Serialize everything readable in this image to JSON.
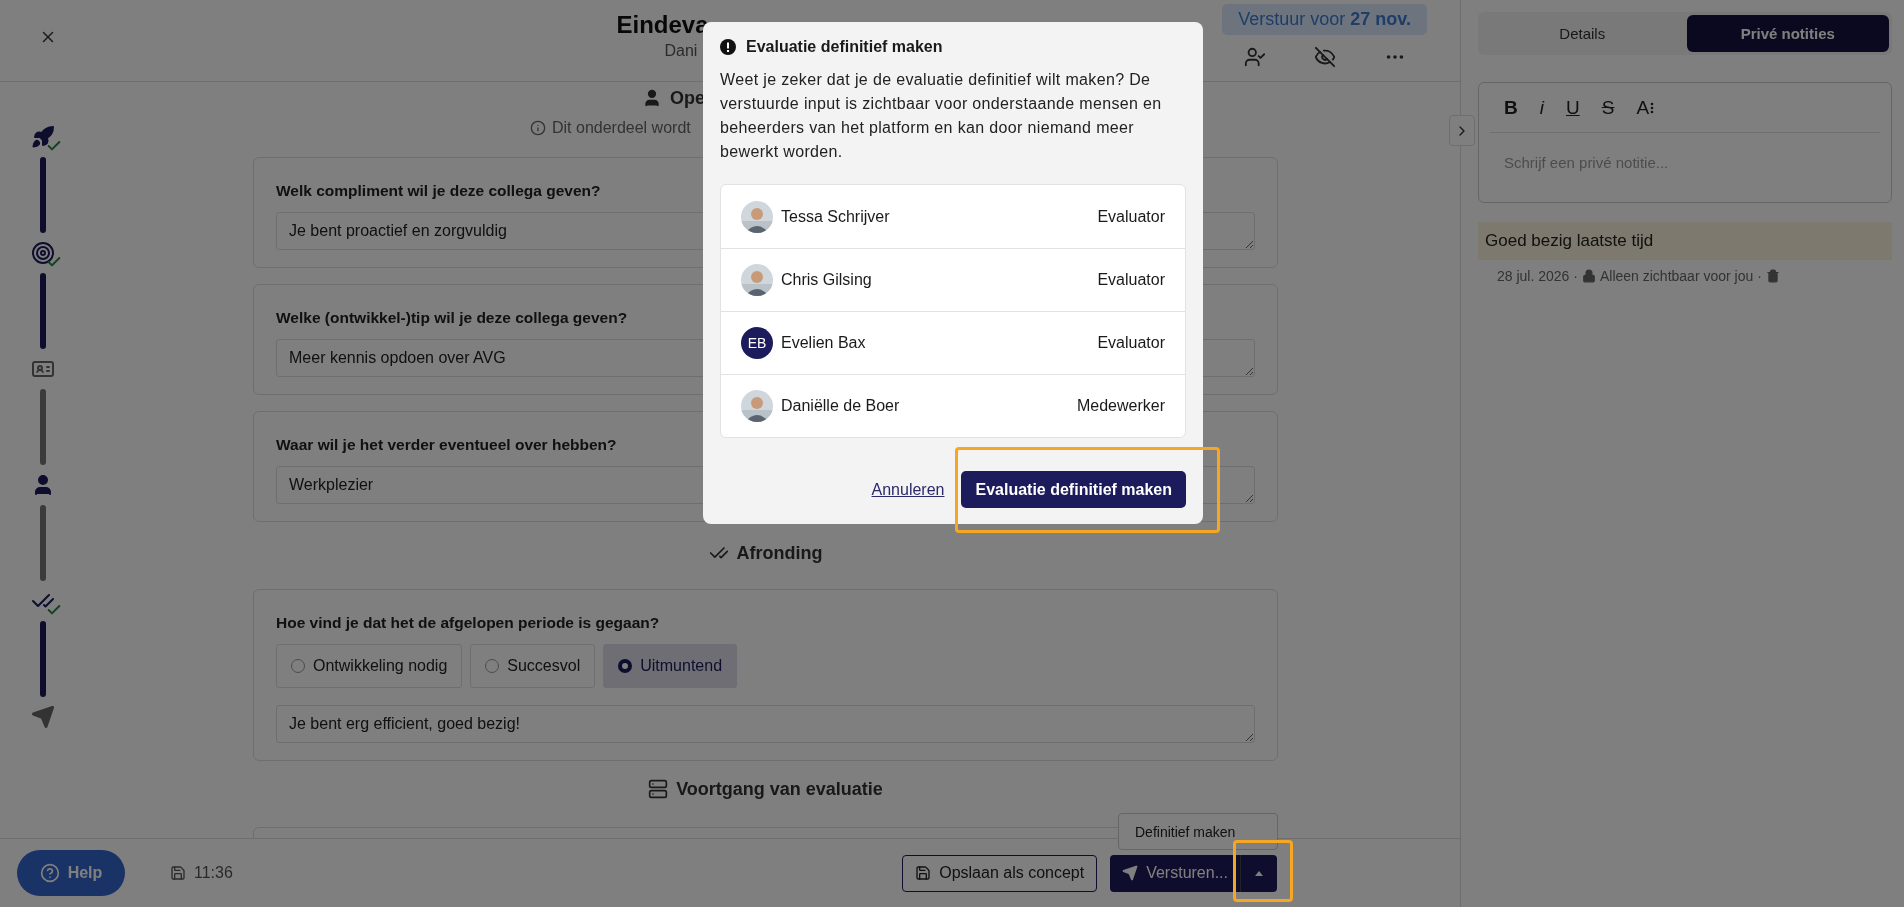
{
  "header": {
    "title": "Eindeva",
    "subtitle": "Dani",
    "deadline_badge": "Verstuur voor **27 nov.**"
  },
  "stepper": [
    {
      "kind": "rocket",
      "done": true,
      "current": false,
      "line_done": true
    },
    {
      "kind": "target",
      "done": true,
      "current": false,
      "line_done": true
    },
    {
      "kind": "id-card",
      "done": false,
      "current": false,
      "line_done": false
    },
    {
      "kind": "person",
      "done": false,
      "current": true,
      "line_done": false
    },
    {
      "kind": "checks",
      "done": true,
      "current": false,
      "line_done": true
    },
    {
      "kind": "send",
      "done": false,
      "current": false
    }
  ],
  "section": {
    "title": "Ope",
    "note": "Dit onderdeel wordt"
  },
  "questions": [
    {
      "question": "Welk compliment wil je deze collega geven?",
      "answer": "Je bent proactief en zorgvuldig"
    },
    {
      "question": "Welke (ontwikkel-)tip wil je deze collega geven?",
      "answer": "Meer kennis opdoen over AVG"
    },
    {
      "question": "Waar wil je het verder eventueel over hebben?",
      "answer": "Werkplezier"
    }
  ],
  "closing": {
    "title": "Afronding",
    "question": "Hoe vind je dat het de afgelopen periode is gegaan?",
    "options": [
      {
        "label": "Ontwikkeling nodig",
        "selected": false
      },
      {
        "label": "Succesvol",
        "selected": false
      },
      {
        "label": "Uitmuntend",
        "selected": true
      }
    ],
    "answer": "Je bent erg efficient, goed bezig!"
  },
  "progress_title": "Voortgang van evaluatie",
  "footer": {
    "help": "Help",
    "saved_time": "11:36",
    "save_draft": "Opslaan als concept",
    "send": "Versturen...",
    "menu_item": "Definitief maken"
  },
  "side_panel": {
    "tabs": [
      {
        "label": "Details",
        "selected": false
      },
      {
        "label": "Privé notities",
        "selected": true
      }
    ],
    "toolbar": [
      {
        "kind": "bold",
        "label": "B"
      },
      {
        "kind": "italic",
        "label": "i"
      },
      {
        "kind": "underline",
        "label": "U"
      },
      {
        "kind": "strike",
        "label": "S"
      },
      {
        "kind": "size",
        "label": "A"
      }
    ],
    "placeholder": "Schrijf een privé notitie...",
    "notes": [
      {
        "text": "Goed bezig laatste tijd",
        "date": "28 jul. 2026 ·",
        "visibility": "Alleen zichtbaar voor jou ·"
      }
    ]
  },
  "dialog": {
    "title": "Evaluatie definitief maken",
    "message": "Weet je zeker dat je de evaluatie definitief wilt maken? De verstuurde input is zichtbaar voor onderstaande mensen en beheerders van het platform en kan door niemand meer bewerkt worden.",
    "people": [
      {
        "name": "Tessa Schrijver",
        "role": "Evaluator"
      },
      {
        "name": "Chris Gilsing",
        "role": "Evaluator"
      },
      {
        "name": "Evelien Bax",
        "role": "Evaluator",
        "kind": "initials",
        "initials": "EB"
      },
      {
        "name": "Daniëlle de Boer",
        "role": "Medewerker"
      }
    ],
    "cancel": "Annuleren",
    "confirm": "Evaluatie definitief maken"
  }
}
